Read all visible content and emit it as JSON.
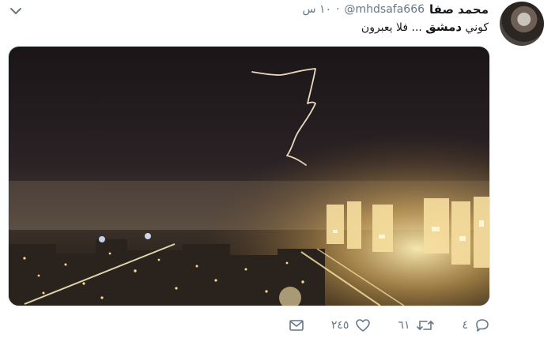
{
  "tweet": {
    "display_name": "محمد صفا",
    "handle": "@mhdsafa666",
    "dot": "·",
    "time": "١٠ س",
    "text_before": "كوني ",
    "hashtag": "دمشق",
    "text_after": " ... فلا يعبرون"
  },
  "actions": {
    "reply_count": "٤",
    "retweet_count": "٦١",
    "like_count": "٢٤٥"
  },
  "icons": {
    "caret": "chevron-down-icon",
    "reply": "reply-icon",
    "retweet": "retweet-icon",
    "like": "heart-icon",
    "message": "envelope-icon"
  },
  "colors": {
    "text": "#14171a",
    "secondary": "#657786",
    "border": "#e1e8ed"
  }
}
